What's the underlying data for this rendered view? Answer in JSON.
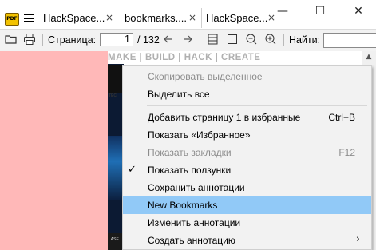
{
  "tabs": [
    {
      "label": "HackSpace...",
      "close": "×",
      "active": false
    },
    {
      "label": "bookmarks....",
      "close": "×",
      "active": false
    },
    {
      "label": "HackSpace...",
      "close": "×",
      "active": true
    }
  ],
  "window": {
    "minimize": "—",
    "maximize": "☐",
    "close": "✕"
  },
  "toolbar": {
    "page_label": "Страница:",
    "page_value": "1",
    "page_total": "/ 132",
    "find_label": "Найти:"
  },
  "document": {
    "banner": "MAKE | BUILD | HACK | CREATE",
    "cover_tec": "TEC",
    "cover_lase": "LASE"
  },
  "menu": {
    "items": [
      {
        "label": "Скопировать выделенное",
        "shortcut": "",
        "disabled": true
      },
      {
        "label": "Выделить все",
        "shortcut": "",
        "disabled": false
      },
      {
        "label": "Добавить страницу 1 в избранные",
        "shortcut": "Ctrl+B",
        "disabled": false
      },
      {
        "label": "Показать «Избранное»",
        "shortcut": "",
        "disabled": false
      },
      {
        "label": "Показать закладки",
        "shortcut": "F12",
        "disabled": true
      },
      {
        "label": "Показать ползунки",
        "shortcut": "",
        "disabled": false,
        "checked": true,
        "check": "✓"
      },
      {
        "label": "Сохранить аннотации",
        "shortcut": "",
        "disabled": false
      },
      {
        "label": "New Bookmarks",
        "shortcut": "",
        "disabled": false,
        "highlighted": true
      },
      {
        "label": "Изменить аннотации",
        "shortcut": "",
        "disabled": false
      },
      {
        "label": "Создать аннотацию",
        "shortcut": "",
        "disabled": false,
        "submenu_arrow": "›"
      }
    ]
  },
  "colors": {
    "background": "#ffb8b8",
    "highlight": "#91c9f7",
    "menu_bg": "#f2f2f2"
  }
}
